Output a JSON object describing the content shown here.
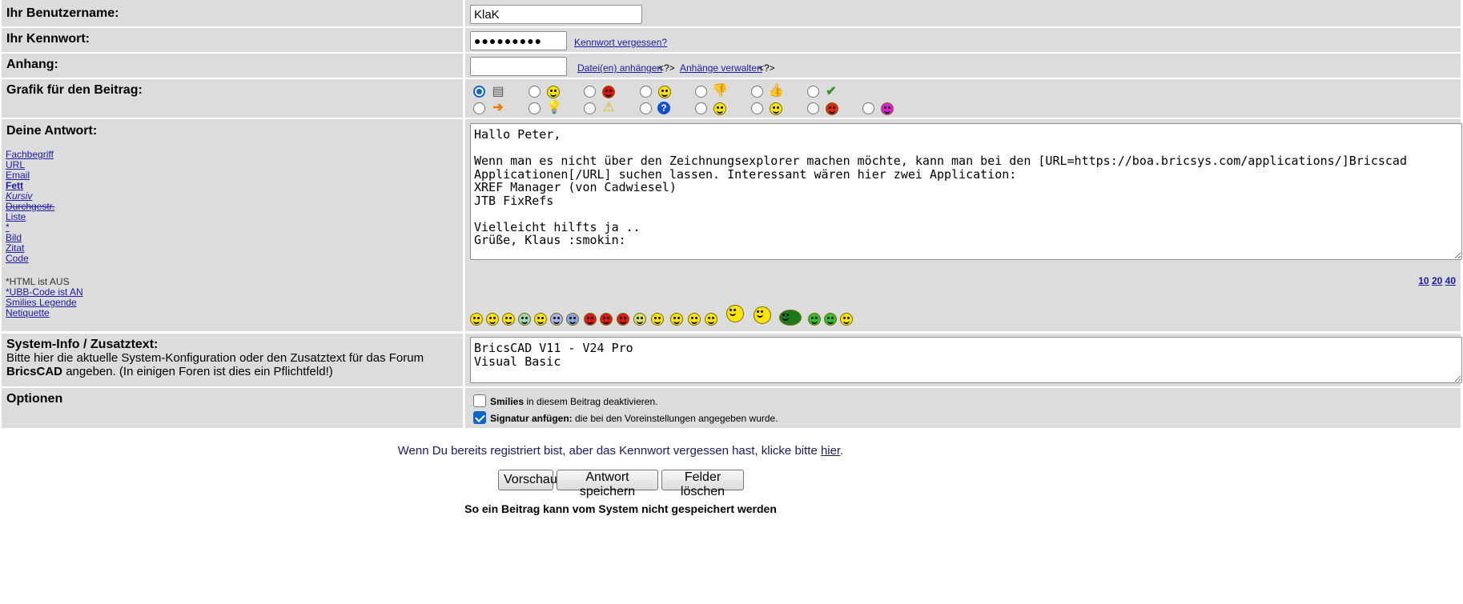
{
  "username": {
    "label": "Ihr Benutzername:",
    "value": "KlaK"
  },
  "password": {
    "label": "Ihr Kennwort:",
    "value": "●●●●●●●●●",
    "forgot_link": "Kennwort vergessen?"
  },
  "attachment": {
    "label": "Anhang:",
    "add_link": "Datei(en) anhängen",
    "help1": "<?>",
    "manage_link": "Anhänge verwalten",
    "help2": "<?>"
  },
  "post_icon": {
    "label": "Grafik für den Beitrag:",
    "row1": [
      "document-icon",
      "laughing-smiley-icon",
      "angry-red-smiley-icon",
      "smiley-icon",
      "thumbs-down-icon",
      "thumbs-up-icon",
      "checkmark-icon"
    ],
    "row2": [
      "arrow-right-icon",
      "lightbulb-icon",
      "warning-icon",
      "question-icon",
      "cool-smiley-icon",
      "wink-smiley-icon",
      "mad-red-smiley-icon",
      "pink-smiley-icon"
    ],
    "selected": "document-icon"
  },
  "reply": {
    "label": "Deine Antwort:",
    "format_links": [
      "Fachbegriff",
      "URL",
      "Email",
      "Fett",
      "Kursiv",
      "Durchgestr.",
      "Liste",
      "*",
      "Bild",
      "Zitat",
      "Code"
    ],
    "html_status": "*HTML ist AUS",
    "ubb_status": "*UBB-Code ist AN",
    "smilies_legend": "Smilies Legende",
    "netiquette": "Netiquette",
    "text": "Hallo Peter,\n\nWenn man es nicht über den Zeichnungsexplorer machen möchte, kann man bei den [URL=https://boa.bricsys.com/applications/]Bricscad Applicationen[/URL] suchen lassen. Interessant wären hier zwei Application:\nXREF Manager (von Cadwiesel)\nJTB FixRefs\n\nVielleicht hilfts ja ..\nGrüße, Klaus :smokin:",
    "size_links": [
      "10",
      "20",
      "40"
    ]
  },
  "sysinfo": {
    "label": "System-Info / Zusatztext:",
    "desc_part1": "Bitte hier die aktuelle System-Konfiguration oder den Zusatztext für das Forum ",
    "desc_bold": "BricsCAD",
    "desc_part2": " angeben. (In einigen Foren ist dies ein Pflichtfeld!)",
    "text": "BricsCAD V11 - V24 Pro\nVisual Basic"
  },
  "options": {
    "label": "Optionen",
    "opt1_bold": "Smilies",
    "opt1_rest": " in diesem Beitrag deaktivieren.",
    "opt1_checked": false,
    "opt2_bold": "Signatur anfügen:",
    "opt2_rest": " die bei den Voreinstellungen angegeben wurde.",
    "opt2_checked": true
  },
  "footer": {
    "forgot_text": "Wenn Du bereits registriert bist, aber das Kennwort vergessen hast, klicke bitte ",
    "forgot_link": "hier",
    "forgot_end": ".",
    "preview_button": "Vorschau",
    "save_button": "Antwort speichern",
    "clear_button": "Felder löschen",
    "warning": "So ein Beitrag kann vom System nicht gespeichert werden"
  }
}
